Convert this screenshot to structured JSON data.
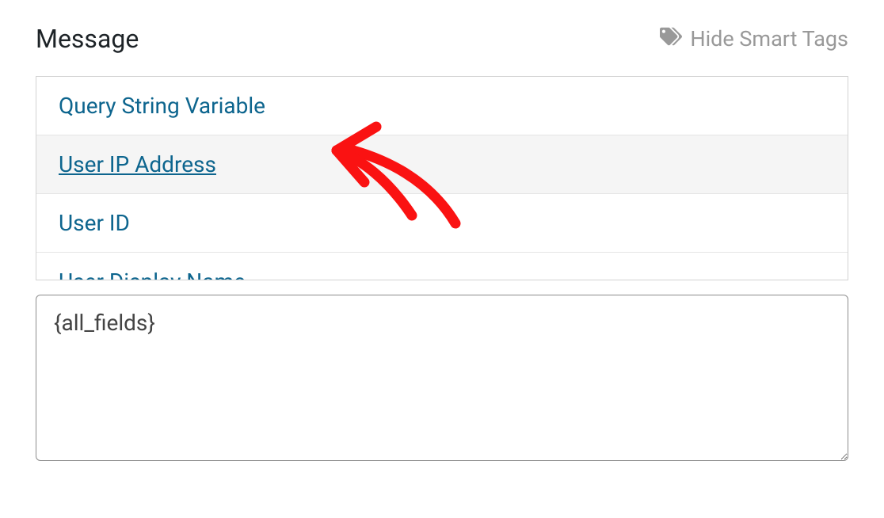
{
  "section_title": "Message",
  "hide_smart_tags_label": "Hide Smart Tags",
  "smart_tags": {
    "items": [
      {
        "label": "Query String Variable",
        "active": false
      },
      {
        "label": "User IP Address",
        "active": true
      },
      {
        "label": "User ID",
        "active": false
      },
      {
        "label": "User Display Name",
        "active": false,
        "partial": true
      }
    ]
  },
  "textarea_value": "{all_fields}"
}
